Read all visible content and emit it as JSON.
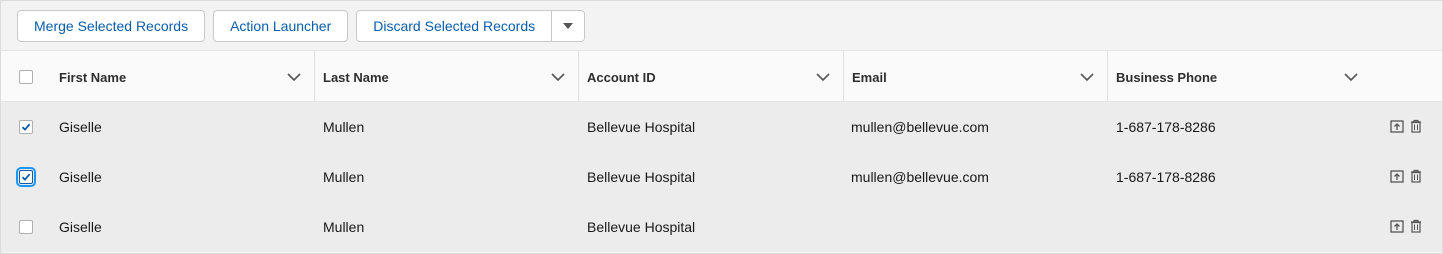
{
  "toolbar": {
    "merge_label": "Merge Selected Records",
    "action_label": "Action Launcher",
    "discard_label": "Discard Selected Records"
  },
  "columns": [
    {
      "key": "first_name",
      "label": "First Name"
    },
    {
      "key": "last_name",
      "label": "Last Name"
    },
    {
      "key": "account_id",
      "label": "Account ID"
    },
    {
      "key": "email",
      "label": "Email"
    },
    {
      "key": "business_phone",
      "label": "Business Phone"
    }
  ],
  "rows": [
    {
      "checked": true,
      "first_name": "Giselle",
      "last_name": "Mullen",
      "account_id": "Bellevue Hospital",
      "email": "mullen@bellevue.com",
      "business_phone": "1-687-178-8286"
    },
    {
      "checked": true,
      "first_name": "Giselle",
      "last_name": "Mullen",
      "account_id": "Bellevue Hospital",
      "email": "mullen@bellevue.com",
      "business_phone": "1-687-178-8286"
    },
    {
      "checked": false,
      "first_name": "Giselle",
      "last_name": "Mullen",
      "account_id": "Bellevue Hospital",
      "email": "",
      "business_phone": ""
    }
  ],
  "colors": {
    "accent": "#0b5cab",
    "header_bg": "#fafafa",
    "row_bg": "#ececec",
    "frame_bg": "#f3f3f3"
  }
}
